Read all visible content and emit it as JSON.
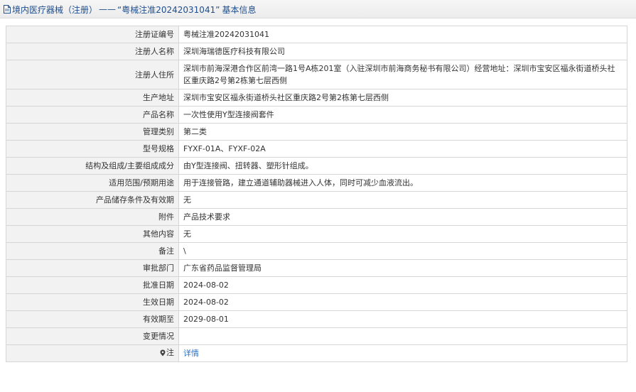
{
  "header": {
    "title": "境内医疗器械（注册）",
    "separator": "——",
    "reg_no": "“粤械注准20242031041”",
    "suffix": "基本信息"
  },
  "rows": [
    {
      "label": "注册证编号",
      "value": "粤械注准20242031041"
    },
    {
      "label": "注册人名称",
      "value": "深圳海瑞德医疗科技有限公司"
    },
    {
      "label": "注册人住所",
      "value": "深圳市前海深港合作区前湾一路1号A栋201室（入驻深圳市前海商务秘书有限公司）经营地址：深圳市宝安区福永街道桥头社区重庆路2号第2栋第七层西侧"
    },
    {
      "label": "生产地址",
      "value": "深圳市宝安区福永街道桥头社区重庆路2号第2栋第七层西侧"
    },
    {
      "label": "产品名称",
      "value": "一次性使用Y型连接阀套件"
    },
    {
      "label": "管理类别",
      "value": "第二类"
    },
    {
      "label": "型号规格",
      "value": "FYXF-01A、FYXF-02A"
    },
    {
      "label": "结构及组成/主要组成成分",
      "value": "由Y型连接阀、扭转器、塑形针组成。"
    },
    {
      "label": "适用范围/预期用途",
      "value": "用于连接管路，建立通道辅助器械进入人体，同时可减少血液流出。"
    },
    {
      "label": "产品储存条件及有效期",
      "value": "无"
    },
    {
      "label": "附件",
      "value": "产品技术要求"
    },
    {
      "label": "其他内容",
      "value": "无"
    },
    {
      "label": "备注",
      "value": "\\"
    },
    {
      "label": "审批部门",
      "value": "广东省药品监督管理局"
    },
    {
      "label": "批准日期",
      "value": "2024-08-02"
    },
    {
      "label": "生效日期",
      "value": "2024-08-02"
    },
    {
      "label": "有效期至",
      "value": "2029-08-01"
    },
    {
      "label": "变更情况",
      "value": ""
    }
  ],
  "note": {
    "label": "注",
    "link": "详情"
  },
  "colors": {
    "link": "#2a72c8",
    "header_text": "#1f4e8c",
    "label_bg": "#f2f2f2",
    "border": "#d6d6d6"
  }
}
